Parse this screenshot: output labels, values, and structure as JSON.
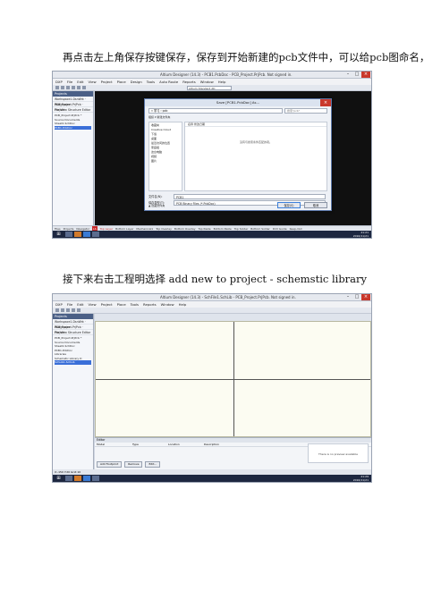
{
  "paragraphs": {
    "first": "再点击左上角保存按键保存，保存到开始新建的pcb文件中，可以给pcb图命名，",
    "second": "接下来右击工程明选择 add new to project - schemstic library"
  },
  "shot1": {
    "title": "Altium Designer (14.3) - PCB1.PcbDoc - PCB_Project.PrjPcb. Not signed in.",
    "menu": [
      "DXP",
      "File",
      "Edit",
      "View",
      "Project",
      "Place",
      "Design",
      "Tools",
      "Auto Route",
      "Reports",
      "Window",
      "Help"
    ],
    "toolbar_field": "Altium Standard 2D",
    "panel": {
      "header": "Projects",
      "workspace": "Workspace1.DsnWrk",
      "workspace_btn": "Workspace",
      "project": "PCB_Project.PrjPcb",
      "project_btn": "Project",
      "view_modes": "File View   Structure Editor",
      "tree": [
        "PCB_Project.PrjPcb *",
        "Source Documents",
        "Sheet1.SchDoc",
        "PCB1.PcbDoc"
      ]
    },
    "dialog": {
      "title": "Save [PCB1.PcbDoc] As...",
      "path": "« 学习 › pcb",
      "search_placeholder": "搜索\"pcb\"",
      "tools": "组织 ▾    新建文件夹",
      "nav": [
        "收藏夹",
        "Creative Cloud",
        "下载",
        "桌面",
        "最近访问的位置",
        "家庭组",
        "这台电脑",
        "视频",
        "图片"
      ],
      "list_cols": "名称                 修改日期",
      "empty_text": "没有与搜索条件匹配的项。",
      "filename_label": "文件名(N):",
      "filename_value": "PCB1",
      "filetype_label": "保存类型(T):",
      "filetype_value": "PCB Binary Files (*.PcbDoc)",
      "hide_folders": "▲ 隐藏文件夹",
      "save_btn": "保存(S)",
      "cancel_btn": "取消"
    },
    "bottom_tabs": [
      "Files",
      "Projects",
      "Navigator",
      "LS",
      "Top Layer",
      "Bottom Layer",
      "Mechanical1",
      "Top Overlay",
      "Bottom Overlay",
      "Top Paste",
      "Bottom Paste",
      "Top Solder",
      "Bottom Solder",
      "Drill Guide",
      "Keep-Out"
    ],
    "clock_time": "21:21",
    "clock_date": "2016/11/21"
  },
  "shot2": {
    "title": "Altium Designer (14.3) - SchFile1.SchLib - PCB_Project.PrjPcb. Not signed in.",
    "menu": [
      "DXP",
      "File",
      "Edit",
      "View",
      "Project",
      "Place",
      "Tools",
      "Reports",
      "Window",
      "Help"
    ],
    "sheet_tabs": [
      "Sheet1.SchDoc",
      "PCB1.PcbDoc",
      "SchLib1.SchLib"
    ],
    "panel": {
      "header": "Projects",
      "workspace": "Workspace1.DsnWrk",
      "workspace_btn": "Workspace",
      "project": "PCB_Project.PrjPcb",
      "project_btn": "Project",
      "view_modes": "File View   Structure Editor",
      "tree": [
        "PCB_Project.PrjPcb *",
        "Source Documents",
        "Sheet1.SchDoc",
        "PCB1.PcbDoc",
        "Libraries",
        "Schematic Library D",
        "SchLib1.SchLib"
      ]
    },
    "bottom_panel": {
      "title": "Editor",
      "cols": [
        "Model",
        "Type",
        "Location",
        "Description"
      ],
      "preview_text": "There is no preview available",
      "buttons": [
        "Add Footprint",
        "Remove",
        "Edit..."
      ]
    },
    "status": "X:-150 Y:20  Grid:10",
    "clock_time": "21:29",
    "clock_date": "2016/11/21"
  }
}
